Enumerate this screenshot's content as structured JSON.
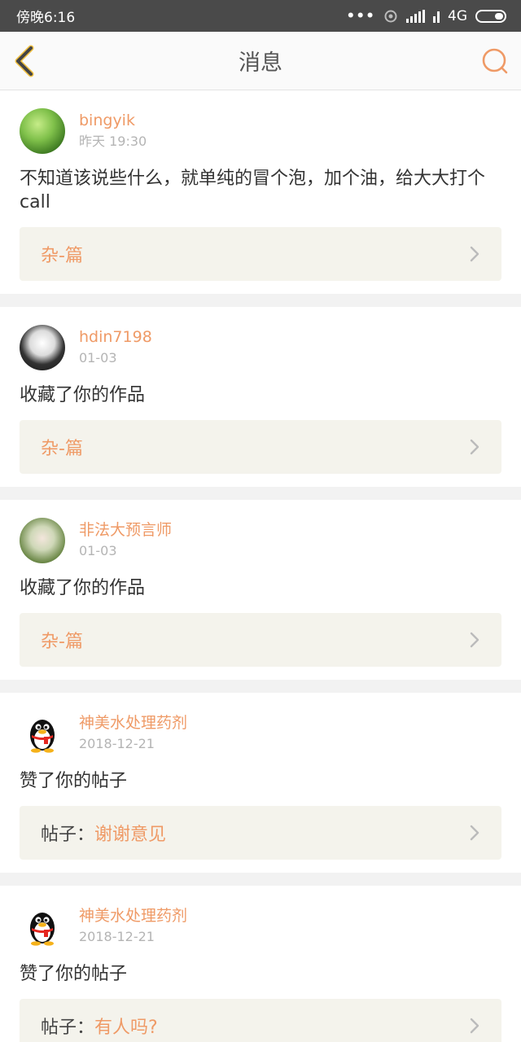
{
  "status_bar": {
    "time": "傍晚6:16",
    "network": "4G"
  },
  "header": {
    "title": "消息",
    "back_icon": "chevron-left-icon",
    "search_icon": "search-icon",
    "accent_color": "#ef9a66"
  },
  "messages": [
    {
      "name": "bingyik",
      "time": "昨天 19:30",
      "content": "不知道该说些什么，就单纯的冒个泡，加个油，给大大打个call",
      "ref_prefix": "",
      "ref_title": "杂-篇",
      "avatar": "leaf-avatar"
    },
    {
      "name": "hdin7198",
      "time": "01-03",
      "content": "收藏了你的作品",
      "ref_prefix": "",
      "ref_title": "杂-篇",
      "avatar": "bw-portrait-avatar"
    },
    {
      "name": "非法大预言师",
      "time": "01-03",
      "content": "收藏了你的作品",
      "ref_prefix": "",
      "ref_title": "杂-篇",
      "avatar": "girl-portrait-avatar"
    },
    {
      "name": "神美水处理药剂",
      "time": "2018-12-21",
      "content": "赞了你的帖子",
      "ref_prefix": "帖子：",
      "ref_title": "谢谢意见",
      "avatar": "qq-penguin-avatar"
    },
    {
      "name": "神美水处理药剂",
      "time": "2018-12-21",
      "content": "赞了你的帖子",
      "ref_prefix": "帖子：",
      "ref_title": "有人吗?",
      "avatar": "qq-penguin-avatar"
    }
  ]
}
